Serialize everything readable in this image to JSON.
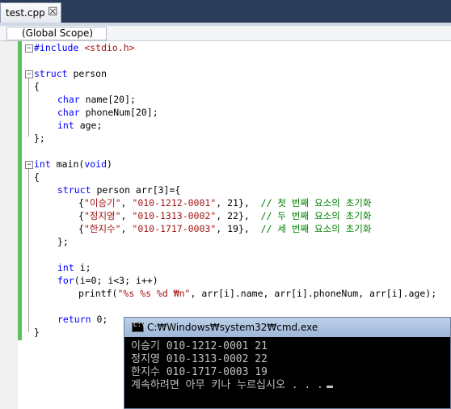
{
  "tab": {
    "filename": "test.cpp",
    "close": "☒"
  },
  "scope": {
    "label": "(Global Scope)"
  },
  "code": {
    "l1": {
      "pp": "#include",
      "inc": " <stdio.h>"
    },
    "l3": {
      "kw": "struct",
      "rest": " person"
    },
    "l4": "{",
    "l6": {
      "kw": "char",
      "rest": " name[20];"
    },
    "l7": {
      "kw": "char",
      "rest": " phoneNum[20];"
    },
    "l8": {
      "kw": "int",
      "rest": " age;"
    },
    "l9": "};",
    "l11": {
      "kw": "int",
      "rest": " main(",
      "kw2": "void",
      "rest2": ")"
    },
    "l12": "{",
    "l13": {
      "kw": "struct",
      "rest": " person arr[3]={"
    },
    "l14": {
      "open": "{",
      "s1": "\"이승기\"",
      "c1": ", ",
      "s2": "\"010-1212-0001\"",
      "rest": ", 21},  ",
      "cmt": "// 첫 번째 요소의 초기화"
    },
    "l15": {
      "open": "{",
      "s1": "\"정지영\"",
      "c1": ", ",
      "s2": "\"010-1313-0002\"",
      "rest": ", 22},  ",
      "cmt": "// 두 번째 요소의 초기화"
    },
    "l16": {
      "open": "{",
      "s1": "\"한지수\"",
      "c1": ", ",
      "s2": "\"010-1717-0003\"",
      "rest": ", 19},  ",
      "cmt": "// 세 번째 요소의 초기화"
    },
    "l17": "};",
    "l19": {
      "kw": "int",
      "rest": " i;"
    },
    "l20": {
      "kw": "for",
      "rest": "(i=0; i<3; i++)"
    },
    "l21": {
      "pre": "printf(",
      "str": "\"%s %s %d ₩n\"",
      "rest": ", arr[i].name, arr[i].phoneNum, arr[i].age);"
    },
    "l23": {
      "kw": "return",
      "rest": " 0;"
    },
    "l24": "}"
  },
  "console": {
    "title": "C:₩Windows₩system32₩cmd.exe",
    "prompt_icon": "C:\\",
    "lines": [
      "이승기 010-1212-0001 21",
      "정지영 010-1313-0002 22",
      "한지수 010-1717-0003 19",
      "계속하려면 아무 키나 누르십시오 . . ."
    ]
  },
  "colors": {
    "keyword": "#0000ff",
    "string": "#a31515",
    "comment": "#008000",
    "changebar": "#5fbf5f"
  }
}
